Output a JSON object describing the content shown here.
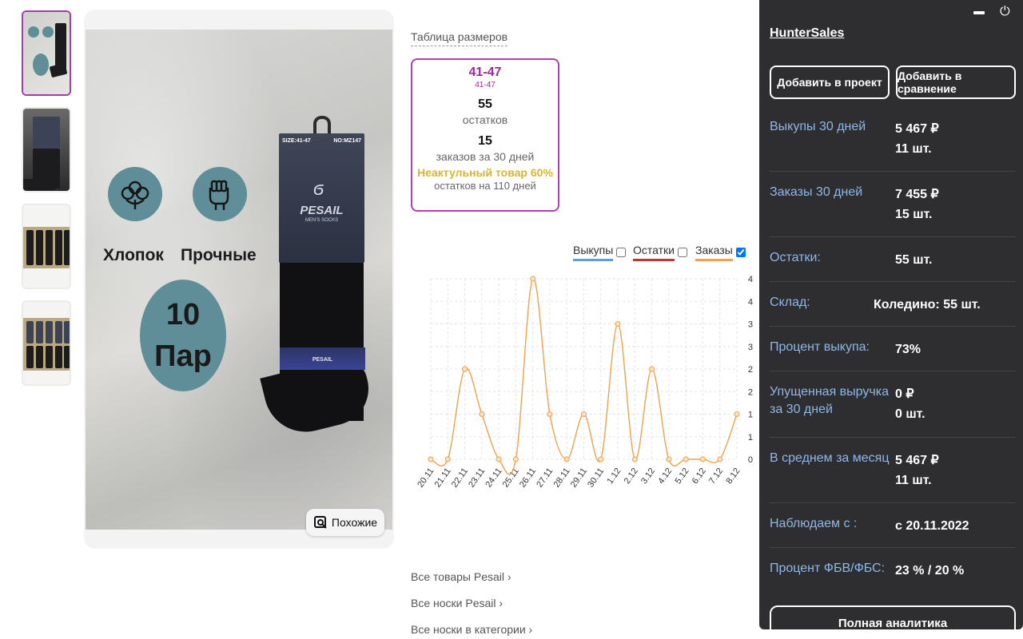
{
  "product_image": {
    "features": [
      {
        "icon": "cotton-flower-icon",
        "label": "Хлопок"
      },
      {
        "icon": "fist-strong-icon",
        "label": "Прочные"
      }
    ],
    "pairs_number": "10",
    "pairs_word": "Пар",
    "pack_size": "SIZE:41-47",
    "pack_no": "NO:MZ147",
    "pack_brand": "PESAIL",
    "pack_sub": "MEN'S SOCKS",
    "band_brand": "PESAIL",
    "similar_label": "Похожие"
  },
  "sizes": {
    "link": "Таблица размеров",
    "size_main": "41-47",
    "size_sub": "41-47",
    "stock_value": "55",
    "stock_label": "остатков",
    "orders_value": "15",
    "orders_label": "заказов за 30 дней",
    "warning": "Неактульный товар 60%",
    "days_label": "остатков на 110 дней"
  },
  "legend": [
    {
      "label": "Выкупы",
      "color": "#5aa0e0",
      "checked": false
    },
    {
      "label": "Остатки",
      "color": "#c0392b",
      "checked": false
    },
    {
      "label": "Заказы",
      "color": "#f0a04a",
      "checked": true
    }
  ],
  "chart_data": {
    "type": "line",
    "x": [
      "20.11",
      "21.11",
      "22.11",
      "23.11",
      "24.11",
      "25.11",
      "26.11",
      "27.11",
      "28.11",
      "29.11",
      "30.11",
      "1.12",
      "2.12",
      "3.12",
      "4.12",
      "5.12",
      "6.12",
      "7.12",
      "8.12"
    ],
    "series": [
      {
        "name": "Заказы",
        "values": [
          0,
          0,
          2,
          1,
          0,
          0,
          4,
          1,
          0,
          1,
          0,
          3,
          0,
          2,
          0,
          0,
          0,
          0,
          1
        ]
      }
    ],
    "y_ticks": [
      "0",
      "1",
      "1",
      "2",
      "2",
      "3",
      "3",
      "4",
      "4"
    ],
    "ylim": [
      0,
      4
    ],
    "grid": true,
    "color": "#f0a04a"
  },
  "links": [
    "Все товары Pesail ›",
    "Все носки Pesail ›",
    "Все носки в категории ›"
  ],
  "panel": {
    "title": "HunterSales",
    "btn_project": "Добавить в проект",
    "btn_compare": "Добавить в сравнение",
    "rows": [
      {
        "key": "Выкупы 30 дней",
        "val1": "5 467 ₽",
        "val2": "11 шт."
      },
      {
        "key": "Заказы 30 дней",
        "val1": "7 455 ₽",
        "val2": "15 шт."
      },
      {
        "key": "Остатки:",
        "val1": "55 шт.",
        "val2": ""
      },
      {
        "key": "Склад:",
        "val1": "Коледино: 55 шт.",
        "val2": ""
      },
      {
        "key": "Процент выкупа:",
        "val1": "73%",
        "val2": ""
      },
      {
        "key": "Упущенная выручка за 30 дней",
        "val1": "0 ₽",
        "val2": "0 шт."
      },
      {
        "key": "В среднем за месяц",
        "val1": "5 467 ₽",
        "val2": "11 шт."
      },
      {
        "key": "Наблюдаем с :",
        "val1": "с 20.11.2022",
        "val2": ""
      },
      {
        "key": "Процент ФБВ/ФБС:",
        "val1": "23 % / 20 %",
        "val2": ""
      }
    ],
    "full_label": "Полная аналитика"
  }
}
